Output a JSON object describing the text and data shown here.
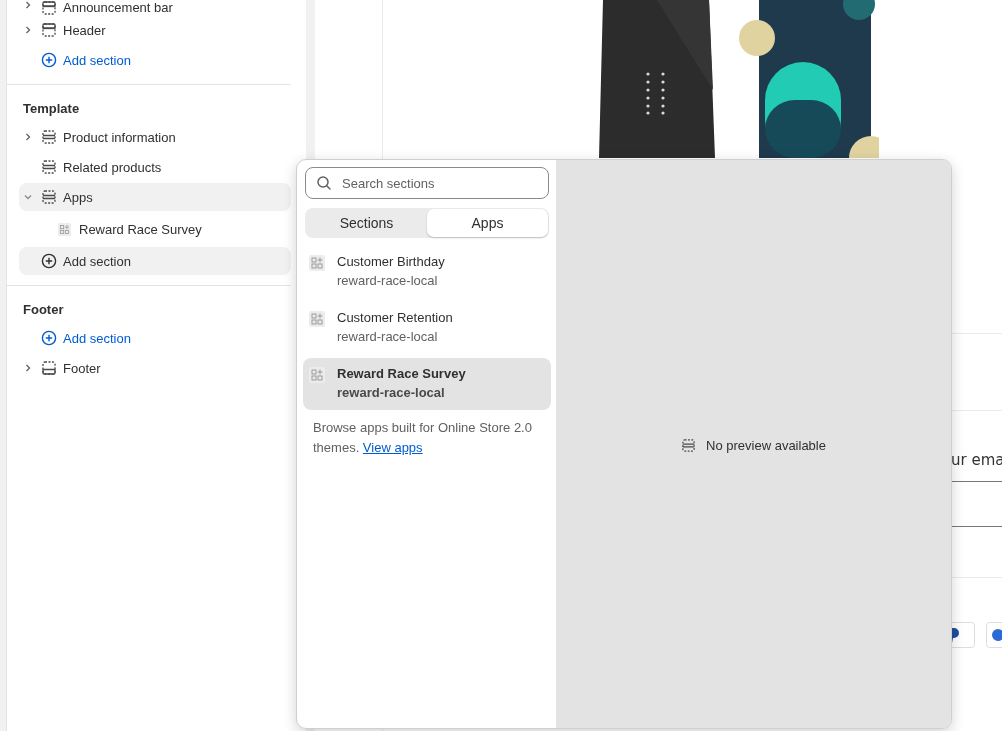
{
  "sidebar": {
    "groups": [
      {
        "items": [
          {
            "kind": "header",
            "label": "Announcement bar",
            "expanded": false,
            "selected": false
          },
          {
            "kind": "header",
            "label": "Header",
            "expanded": false,
            "selected": false
          },
          {
            "kind": "add",
            "label": "Add section",
            "selected": false
          }
        ]
      },
      {
        "heading": "Template",
        "items": [
          {
            "kind": "section",
            "label": "Product information",
            "expanded": false,
            "selected": false
          },
          {
            "kind": "section",
            "label": "Related products",
            "selected": false
          },
          {
            "kind": "section",
            "label": "Apps",
            "expanded": true,
            "selected": true,
            "children": [
              {
                "kind": "block",
                "label": "Reward Race Survey",
                "selected": false
              }
            ]
          },
          {
            "kind": "add",
            "label": "Add section",
            "selected": true
          }
        ]
      },
      {
        "heading": "Footer",
        "items": [
          {
            "kind": "add",
            "label": "Add section",
            "selected": false
          },
          {
            "kind": "footer",
            "label": "Footer",
            "expanded": false,
            "selected": false
          }
        ]
      }
    ]
  },
  "picker": {
    "search": {
      "placeholder": "Search sections"
    },
    "tabs": [
      {
        "label": "Sections",
        "selected": false
      },
      {
        "label": "Apps",
        "selected": true
      }
    ],
    "apps": [
      {
        "title": "Customer Birthday",
        "source": "reward-race-local",
        "selected": false
      },
      {
        "title": "Customer Retention",
        "source": "reward-race-local",
        "selected": false
      },
      {
        "title": "Reward Race Survey",
        "source": "reward-race-local",
        "selected": true
      }
    ],
    "browse_note": {
      "text": "Browse apps built for Online Store 2.0 themes.",
      "link": "View apps"
    },
    "preview_message": "No preview available"
  },
  "store_preview": {
    "email_field_text": "ur ema"
  }
}
